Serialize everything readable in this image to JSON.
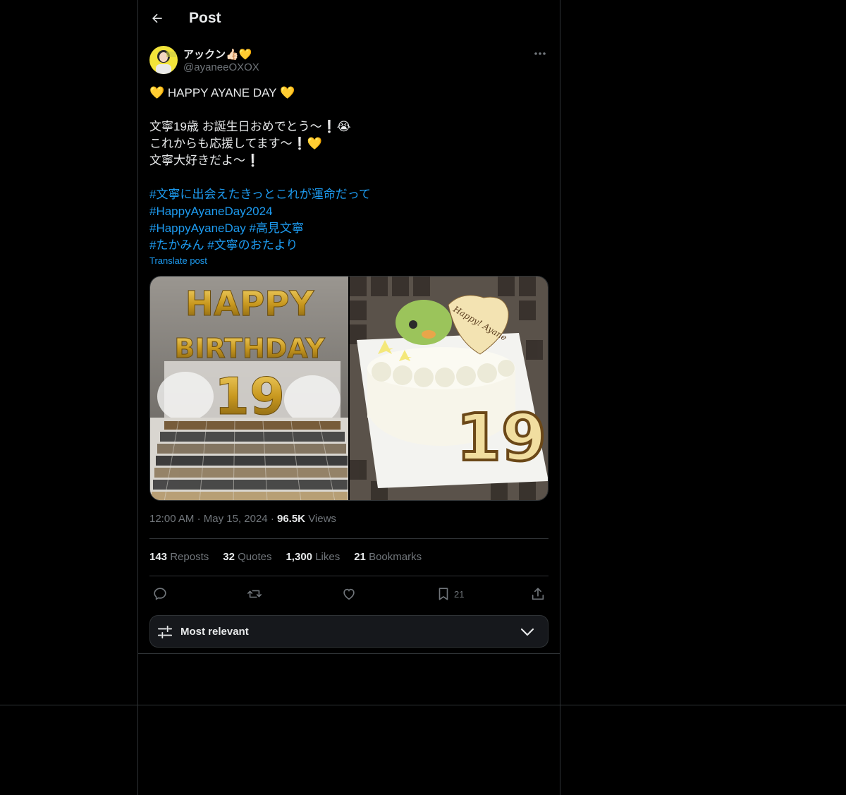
{
  "header": {
    "title": "Post"
  },
  "author": {
    "display_name": "アックン👍🏻💛",
    "handle": "@ayaneeOXOX"
  },
  "post": {
    "lines": [
      "💛 HAPPY AYANE DAY 💛",
      "文寧19歳 お誕生日おめでとう〜❕😭",
      "これからも応援してます〜❕💛",
      "文寧大好きだよ〜❕"
    ],
    "hashtags": [
      "#文寧に出会えたきっとこれが運命だって",
      "#HappyAyaneDay2024",
      "#HappyAyaneDay",
      "#高見文寧",
      "#たかみん",
      "#文寧のおたより"
    ],
    "translate_label": "Translate post"
  },
  "media": {
    "left": {
      "balloon_top": "HAPPY",
      "balloon_middle": "BIRTHDAY",
      "balloon_number": "19"
    },
    "right": {
      "plaque_text": "Happy! Ayane",
      "cake_number": "19"
    }
  },
  "meta": {
    "time": "12:00 AM",
    "sep": "·",
    "date": "May 15, 2024",
    "views_count": "96.5K",
    "views_label": "Views"
  },
  "stats": [
    {
      "count": "143",
      "label": "Reposts"
    },
    {
      "count": "32",
      "label": "Quotes"
    },
    {
      "count": "1,300",
      "label": "Likes"
    },
    {
      "count": "21",
      "label": "Bookmarks"
    }
  ],
  "actions": {
    "bookmark_count": "21"
  },
  "sort": {
    "label": "Most relevant"
  },
  "colors": {
    "background": "#000000",
    "text": "#e7e9ea",
    "muted": "#71767b",
    "accent": "#1d9bf0",
    "border": "#2f3336"
  }
}
